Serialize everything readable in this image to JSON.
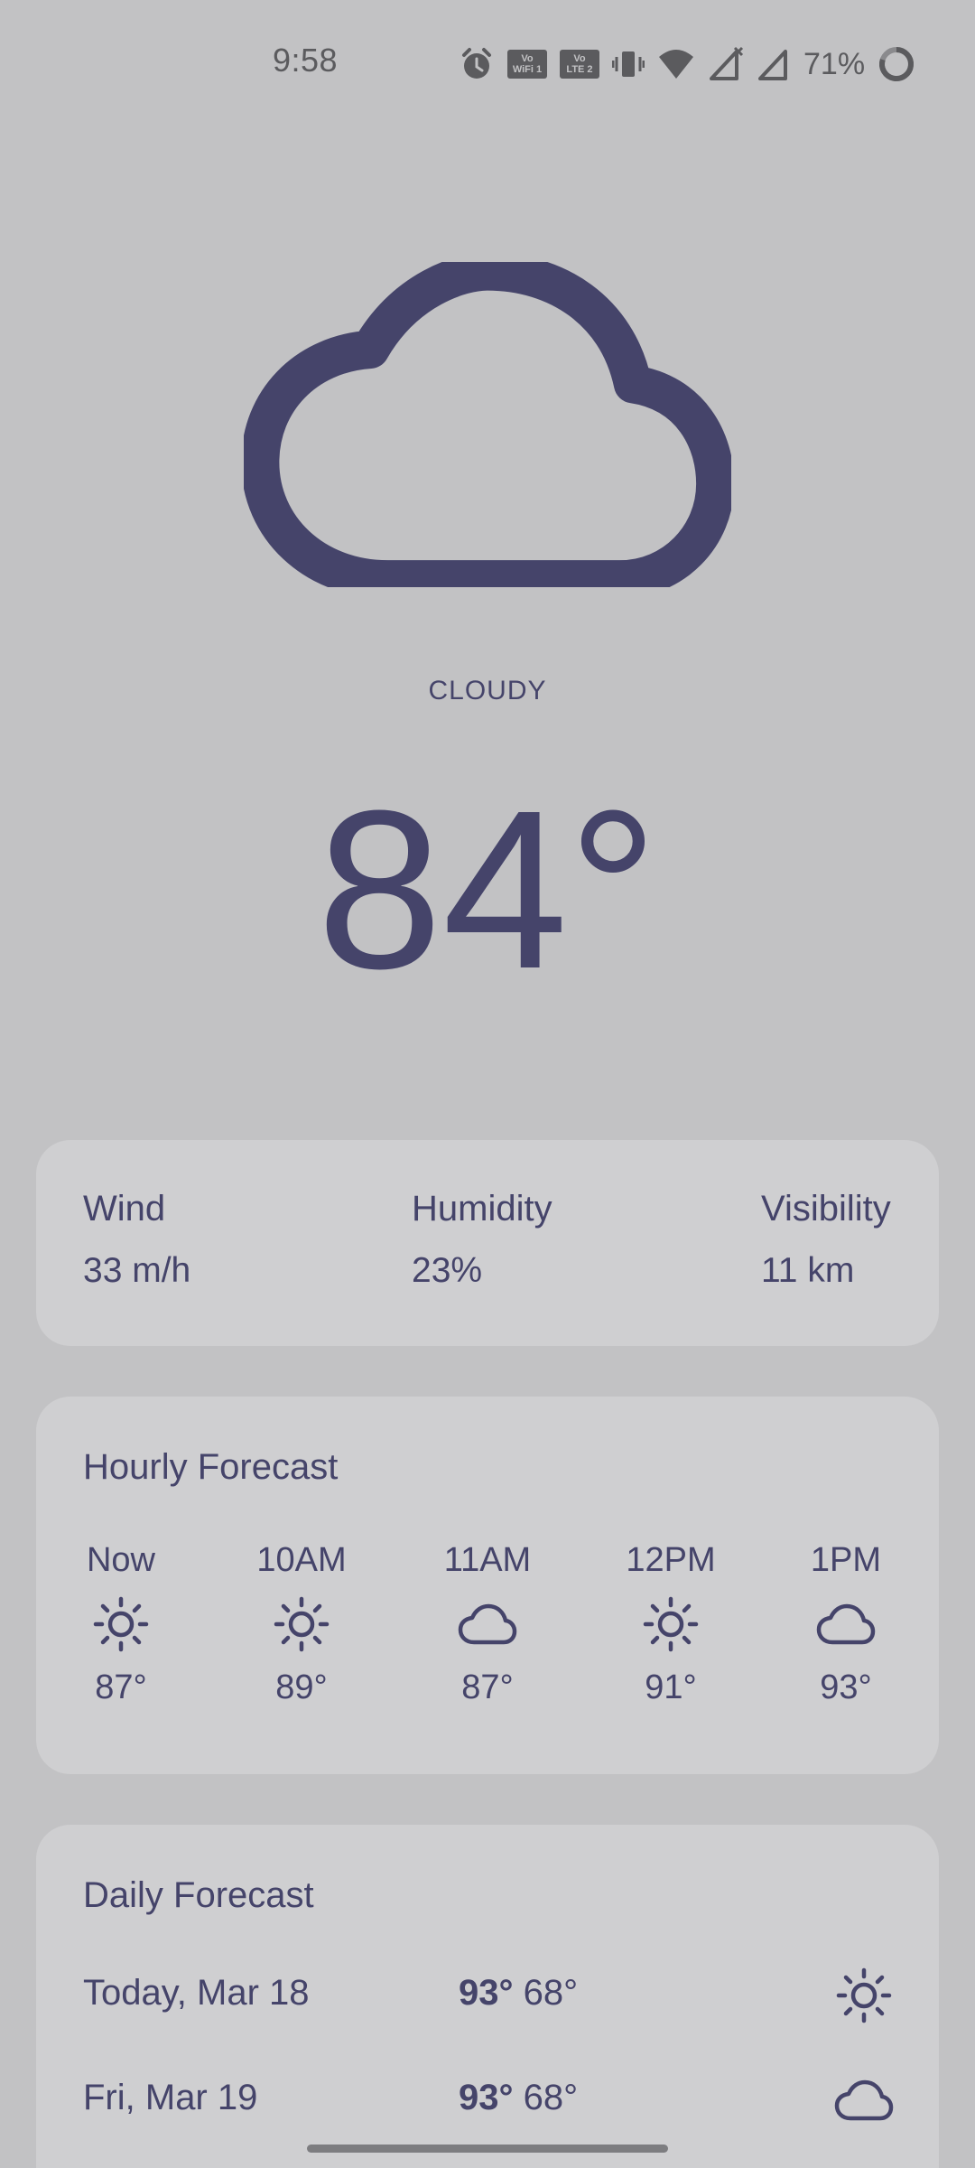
{
  "status_bar": {
    "time": "9:58",
    "battery_percent": "71%",
    "chip_wifi": "Vo WiFi 1",
    "chip_lte": "Vo LTE 2"
  },
  "current": {
    "condition": "CLOUDY",
    "temperature": "84°",
    "icon": "cloud-icon"
  },
  "stats": {
    "wind_label": "Wind",
    "wind_value": "33 m/h",
    "humidity_label": "Humidity",
    "humidity_value": "23%",
    "visibility_label": "Visibility",
    "visibility_value": "11 km"
  },
  "hourly": {
    "title": "Hourly Forecast",
    "items": [
      {
        "time": "Now",
        "icon": "sun-icon",
        "temp": "87°"
      },
      {
        "time": "10AM",
        "icon": "sun-icon",
        "temp": "89°"
      },
      {
        "time": "11AM",
        "icon": "cloud-icon",
        "temp": "87°"
      },
      {
        "time": "12PM",
        "icon": "sun-icon",
        "temp": "91°"
      },
      {
        "time": "1PM",
        "icon": "cloud-icon",
        "temp": "93°"
      }
    ]
  },
  "daily": {
    "title": "Daily Forecast",
    "items": [
      {
        "day": "Today, Mar 18",
        "high": "93°",
        "low": "68°",
        "icon": "sun-icon"
      },
      {
        "day": "Fri, Mar 19",
        "high": "93°",
        "low": "68°",
        "icon": "cloud-icon"
      }
    ]
  },
  "colors": {
    "background": "#c2c2c4",
    "card": "#cfcfd1",
    "accent": "#45446a"
  }
}
